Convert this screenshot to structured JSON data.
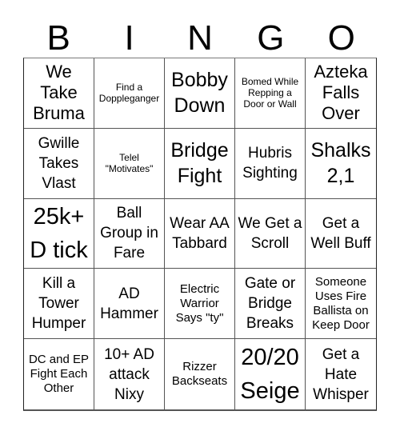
{
  "header": {
    "letters": [
      "B",
      "I",
      "N",
      "G",
      "O"
    ]
  },
  "cells": [
    {
      "text": "We Take Bruma",
      "size": "s-lg"
    },
    {
      "text": "Find a Doppleganger",
      "size": "s-xs"
    },
    {
      "text": "Bobby Down",
      "size": "s-xl"
    },
    {
      "text": "Bomed While Repping a Door or Wall",
      "size": "s-xs"
    },
    {
      "text": "Azteka Falls Over",
      "size": "s-lg"
    },
    {
      "text": "Gwille Takes Vlast",
      "size": "s-md"
    },
    {
      "text": "Telel \"Motivates\"",
      "size": "s-xs"
    },
    {
      "text": "Bridge Fight",
      "size": "s-xl"
    },
    {
      "text": "Hubris Sighting",
      "size": "s-md"
    },
    {
      "text": "Shalks 2,1",
      "size": "s-xl"
    },
    {
      "text": "25k+ D tick",
      "size": "s-xxl"
    },
    {
      "text": "Ball Group in Fare",
      "size": "s-md"
    },
    {
      "text": "Wear AA Tabbard",
      "size": "s-md"
    },
    {
      "text": "We Get a Scroll",
      "size": "s-md"
    },
    {
      "text": "Get a Well Buff",
      "size": "s-md"
    },
    {
      "text": "Kill a Tower Humper",
      "size": "s-md"
    },
    {
      "text": "AD Hammer",
      "size": "s-md"
    },
    {
      "text": "Electric Warrior Says \"ty\"",
      "size": "s-sm"
    },
    {
      "text": "Gate or Bridge Breaks",
      "size": "s-md"
    },
    {
      "text": "Someone Uses Fire Ballista on Keep Door",
      "size": "s-sm"
    },
    {
      "text": "DC and EP Fight Each Other",
      "size": "s-sm"
    },
    {
      "text": "10+ AD attack Nixy",
      "size": "s-md"
    },
    {
      "text": "Rizzer Backseats",
      "size": "s-sm"
    },
    {
      "text": "20/20 Seige",
      "size": "s-xxl"
    },
    {
      "text": "Get a Hate Whisper",
      "size": "s-md"
    }
  ]
}
